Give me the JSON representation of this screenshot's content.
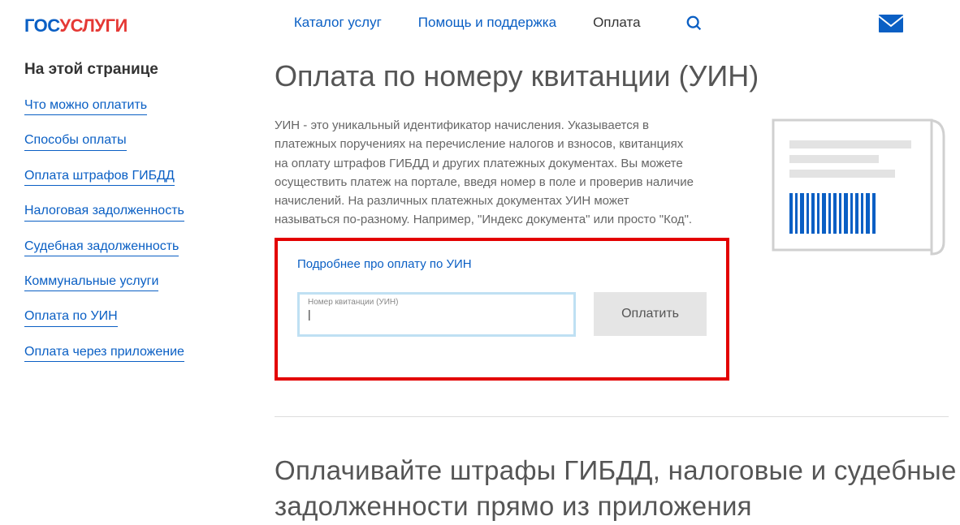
{
  "logo": {
    "part1": "ГОС",
    "part2": "УСЛУГИ"
  },
  "nav": {
    "catalog": "Каталог услуг",
    "help": "Помощь и поддержка",
    "payment": "Оплата"
  },
  "sidebar": {
    "title": "На этой странице",
    "items": [
      "Что можно оплатить",
      "Способы оплаты",
      "Оплата штрафов ГИБДД",
      "Налоговая задолженность",
      "Судебная задолженность",
      "Коммунальные услуги",
      "Оплата по УИН",
      "Оплата через приложение"
    ]
  },
  "main": {
    "title": "Оплата по номеру квитанции (УИН)",
    "description": "УИН - это уникальный идентификатор начисления. Указывается в платежных поручениях на перечисление налогов и взносов, квитанциях на оплату штрафов ГИБДД и других платежных документах. Вы можете осуществить платеж на портале, введя номер в поле и проверив наличие начислений. На различных платежных документах УИН может называться по-разному. Например, \"Индекс документа\" или просто \"Код\".",
    "more_link": "Подробнее про оплату по УИН",
    "input_label": "Номер квитанции (УИН)",
    "input_value": "",
    "pay_button": "Оплатить",
    "section2_title": "Оплачивайте штрафы ГИБДД, налоговые и судебные задолженности прямо из приложения"
  }
}
